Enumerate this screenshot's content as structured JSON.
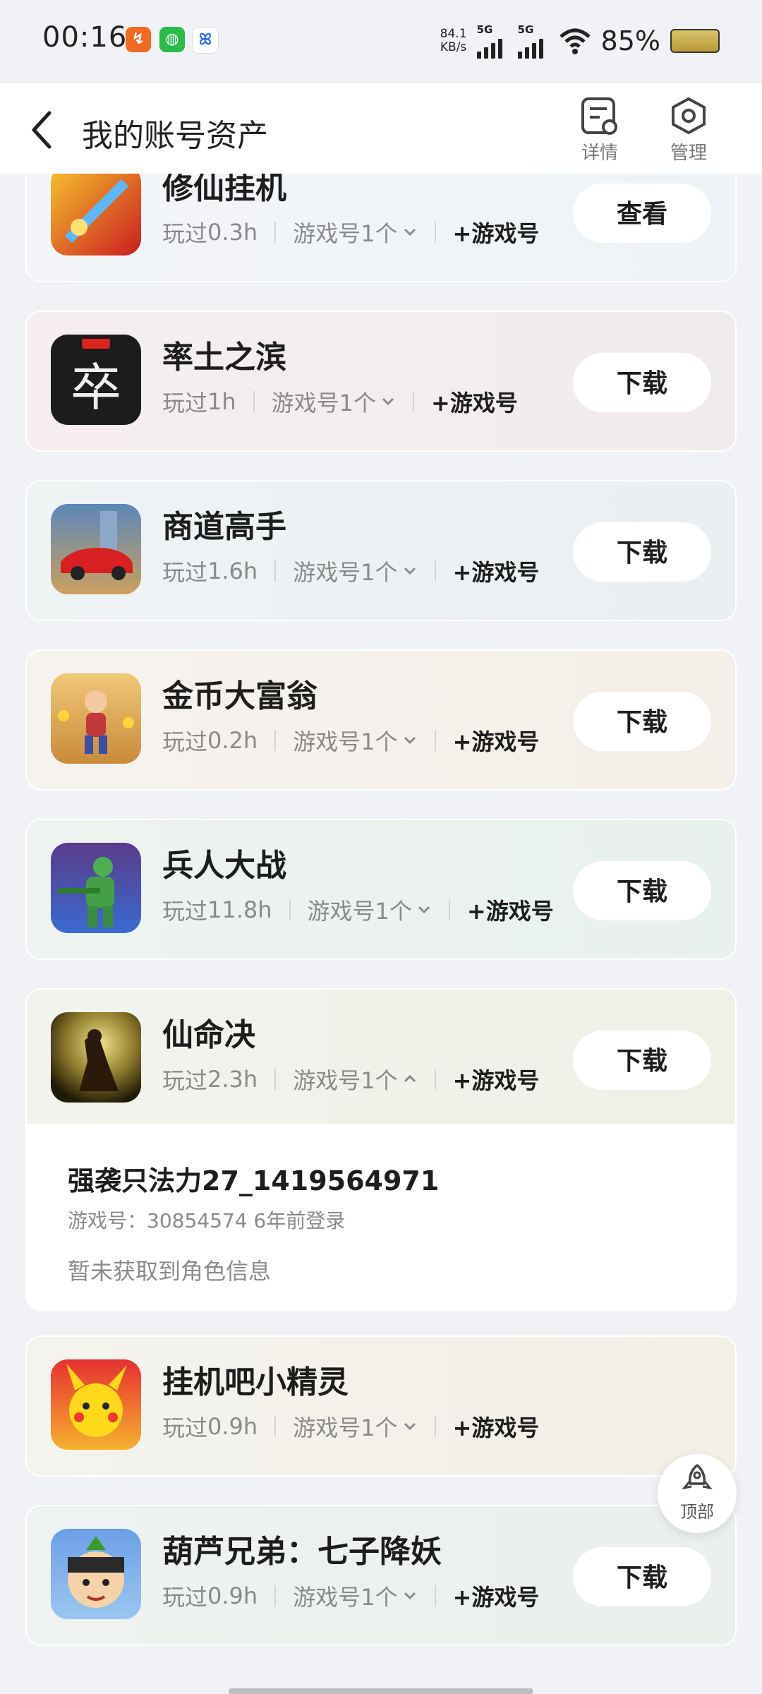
{
  "status_bar": {
    "time": "00:16",
    "speed_value": "84.1",
    "speed_unit": "KB/s",
    "net1": "5G",
    "net2": "5G",
    "battery": "85%"
  },
  "header": {
    "title": "我的账号资产",
    "detail_label": "详情",
    "manage_label": "管理"
  },
  "games": [
    {
      "name": "修仙挂机",
      "played_prefix": "玩过",
      "played": "0.3h",
      "accounts": "游戏号1个",
      "add": "+游戏号",
      "action": "查看",
      "icon": "blade-icon"
    },
    {
      "name": "率土之滨",
      "played_prefix": "玩过",
      "played": "1h",
      "accounts": "游戏号1个",
      "add": "+游戏号",
      "action": "下载",
      "icon": "zu-character-icon"
    },
    {
      "name": "商道高手",
      "played_prefix": "玩过",
      "played": "1.6h",
      "accounts": "游戏号1个",
      "add": "+游戏号",
      "action": "下载",
      "icon": "red-car-icon"
    },
    {
      "name": "金币大富翁",
      "played_prefix": "玩过",
      "played": "0.2h",
      "accounts": "游戏号1个",
      "add": "+游戏号",
      "action": "下载",
      "icon": "running-man-icon"
    },
    {
      "name": "兵人大战",
      "played_prefix": "玩过",
      "played": "11.8h",
      "accounts": "游戏号1个",
      "add": "+游戏号",
      "action": "下载",
      "icon": "green-soldier-icon"
    },
    {
      "name": "仙命决",
      "played_prefix": "玩过",
      "played": "2.3h",
      "accounts": "游戏号1个",
      "add": "+游戏号",
      "action": "下载",
      "icon": "moon-warrior-icon"
    },
    {
      "name": "挂机吧小精灵",
      "played_prefix": "玩过",
      "played": "0.9h",
      "accounts": "游戏号1个",
      "add": "+游戏号",
      "action": "",
      "icon": "pikachu-icon"
    },
    {
      "name": "葫芦兄弟：七子降妖",
      "played_prefix": "玩过",
      "played": "0.9h",
      "accounts": "游戏号1个",
      "add": "+游戏号",
      "action": "下载",
      "icon": "gourd-brother-icon"
    }
  ],
  "expanded_account": {
    "name": "强袭只法力27_1419564971",
    "info": "游戏号：30854574    6年前登录",
    "role": "暂未获取到角色信息"
  },
  "top_button": "顶部",
  "colors": {
    "background": "#f1f2f5",
    "card_white": "#ffffff",
    "text_primary": "#1d1d1d",
    "text_secondary": "#8a8a8a"
  }
}
